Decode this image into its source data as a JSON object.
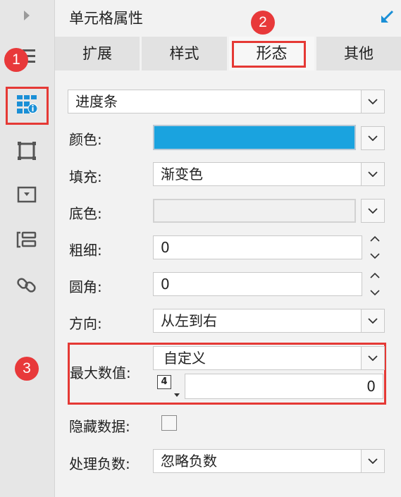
{
  "panel": {
    "title": "单元格属性"
  },
  "tabs": [
    {
      "label": "扩展"
    },
    {
      "label": "样式"
    },
    {
      "label": "形态"
    },
    {
      "label": "其他"
    }
  ],
  "form": {
    "type_value": "进度条",
    "color": {
      "label": "颜色:",
      "value": "#1aa3df"
    },
    "fill": {
      "label": "填充:",
      "value": "渐变色"
    },
    "background": {
      "label": "底色:",
      "value": ""
    },
    "thickness": {
      "label": "粗细:",
      "value": "0"
    },
    "radius": {
      "label": "圆角:",
      "value": "0"
    },
    "direction": {
      "label": "方向:",
      "value": "从左到右"
    },
    "max_value": {
      "label": "最大数值:",
      "mode": "自定义",
      "num_icon": "4",
      "value": "0"
    },
    "hide_data": {
      "label": "隐藏数据:",
      "checked": false
    },
    "negative": {
      "label": "处理负数:",
      "value": "忽略负数"
    }
  },
  "annotations": {
    "badge1": "1",
    "badge2": "2",
    "badge3": "3"
  },
  "colors": {
    "accent": "#1aa3df",
    "highlight": "#e53935",
    "badge": "#e8393a"
  }
}
